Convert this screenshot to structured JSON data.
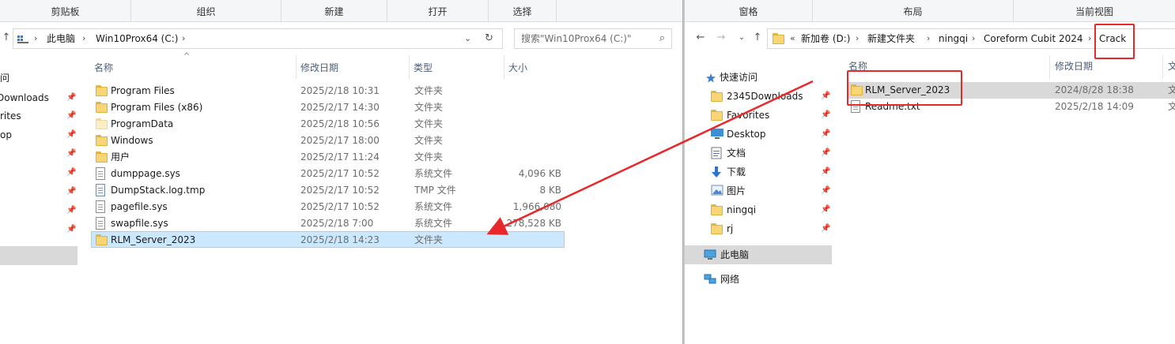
{
  "left": {
    "ribbon": [
      "剪贴板",
      "组织",
      "新建",
      "打开",
      "选择"
    ],
    "breadcrumb": [
      "此电脑",
      "Win10Prox64 (C:)"
    ],
    "refresh_icon": "refresh-icon",
    "search_placeholder": "搜索\"Win10Prox64 (C:)\"",
    "columns": [
      "名称",
      "修改日期",
      "类型",
      "大小"
    ],
    "sidebar_partial": [
      "问",
      "Downloads",
      "rites",
      "op"
    ],
    "rows": [
      {
        "name": "Program Files",
        "date": "2025/2/18 10:31",
        "type": "文件夹",
        "size": "",
        "icon": "folder"
      },
      {
        "name": "Program Files (x86)",
        "date": "2025/2/17 14:30",
        "type": "文件夹",
        "size": "",
        "icon": "folder"
      },
      {
        "name": "ProgramData",
        "date": "2025/2/18 10:56",
        "type": "文件夹",
        "size": "",
        "icon": "folder-hidden"
      },
      {
        "name": "Windows",
        "date": "2025/2/17 18:00",
        "type": "文件夹",
        "size": "",
        "icon": "folder"
      },
      {
        "name": "用户",
        "date": "2025/2/17 11:24",
        "type": "文件夹",
        "size": "",
        "icon": "folder"
      },
      {
        "name": "dumppage.sys",
        "date": "2025/2/17 10:52",
        "type": "系统文件",
        "size": "4,096 KB",
        "icon": "file"
      },
      {
        "name": "DumpStack.log.tmp",
        "date": "2025/2/17 10:52",
        "type": "TMP 文件",
        "size": "8 KB",
        "icon": "file-tmp"
      },
      {
        "name": "pagefile.sys",
        "date": "2025/2/17 10:52",
        "type": "系统文件",
        "size": "1,966,080",
        "icon": "file"
      },
      {
        "name": "swapfile.sys",
        "date": "2025/2/18 7:00",
        "type": "系统文件",
        "size": "278,528 KB",
        "icon": "file"
      },
      {
        "name": "RLM_Server_2023",
        "date": "2025/2/18 14:23",
        "type": "文件夹",
        "size": "",
        "icon": "folder",
        "selected": true
      }
    ]
  },
  "right": {
    "ribbon": [
      "窗格",
      "布局",
      "当前视图"
    ],
    "breadcrumb_prefix": "«",
    "breadcrumb": [
      "新加卷 (D:)",
      "新建文件夹",
      "ningqi",
      "Coreform Cubit 2024",
      "Crack"
    ],
    "columns": [
      "名称",
      "修改日期",
      "文"
    ],
    "rows": [
      {
        "name": "RLM_Server_2023",
        "date": "2024/8/28 18:38",
        "type": "文",
        "icon": "folder",
        "hover": true
      },
      {
        "name": "Readme.txt",
        "date": "2025/2/18 14:09",
        "type": "文",
        "icon": "file"
      }
    ],
    "sidebar": {
      "quick_access": "快速访问",
      "items": [
        {
          "label": "2345Downloads",
          "icon": "folder"
        },
        {
          "label": "Favorites",
          "icon": "folder"
        },
        {
          "label": "Desktop",
          "icon": "desktop"
        },
        {
          "label": "文档",
          "icon": "documents"
        },
        {
          "label": "下载",
          "icon": "download"
        },
        {
          "label": "图片",
          "icon": "pictures"
        },
        {
          "label": "ningqi",
          "icon": "folder"
        },
        {
          "label": "rj",
          "icon": "folder"
        }
      ],
      "this_pc": "此电脑",
      "network": "网络"
    }
  },
  "annotation_color": "#e8282b"
}
